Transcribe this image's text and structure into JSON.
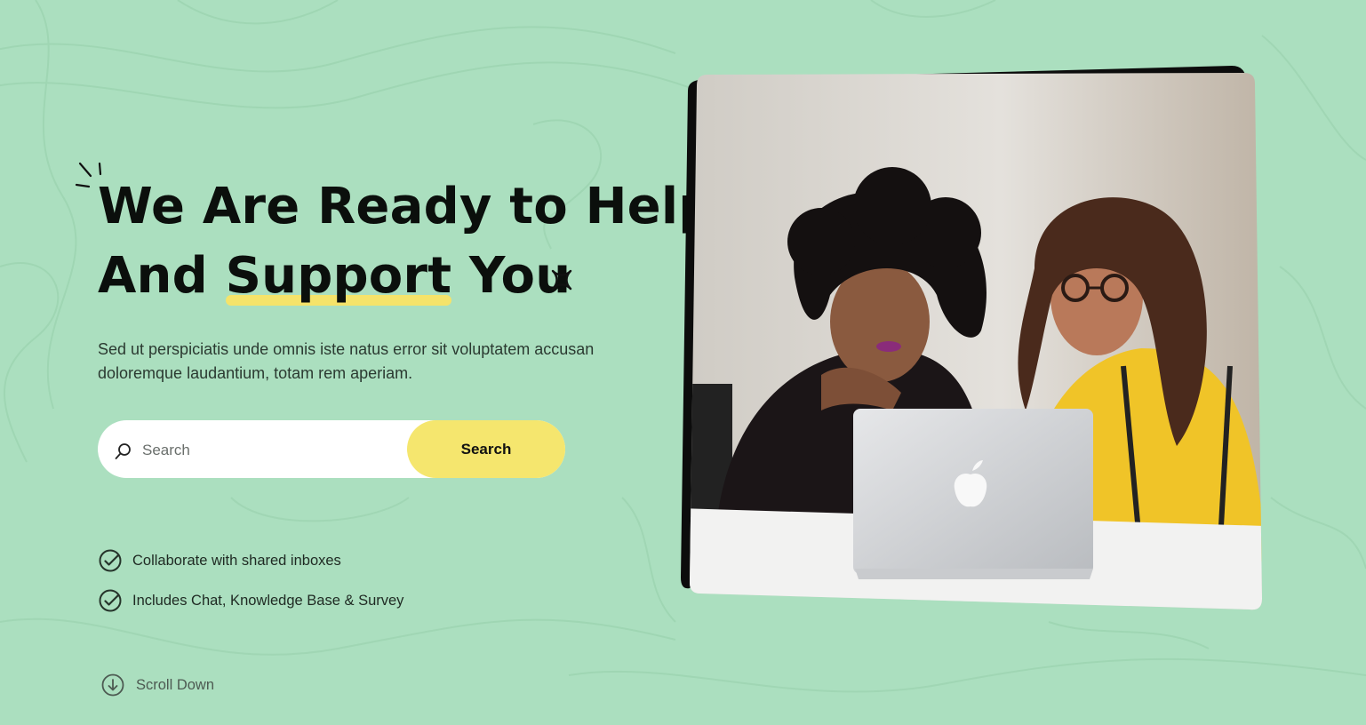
{
  "hero": {
    "headline_line1": "We Are Ready to Help",
    "headline_line2_prefix": "And ",
    "headline_highlight": "Support",
    "headline_line2_suffix": " You",
    "subtitle": "Sed ut perspiciatis unde omnis iste natus error sit voluptatem accusan doloremque laudantium, totam rem aperiam."
  },
  "search": {
    "placeholder": "Search",
    "value": "",
    "button_label": "Search"
  },
  "features": [
    {
      "label": "Collaborate with shared inboxes",
      "icon": "check-circle-icon"
    },
    {
      "label": "Includes Chat, Knowledge Base & Survey",
      "icon": "check-circle-icon"
    }
  ],
  "scroll": {
    "label": "Scroll Down",
    "icon": "arrow-down-circle-icon"
  },
  "colors": {
    "background": "#abdfbf",
    "accent_yellow": "#f5e66e",
    "text_dark": "#0b0f0c"
  }
}
